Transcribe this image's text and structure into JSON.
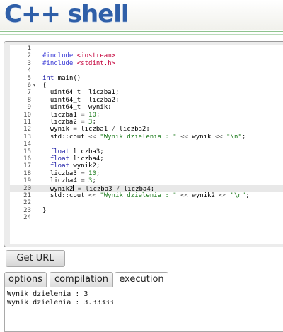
{
  "header": {
    "logo_text": "C++ shell"
  },
  "editor": {
    "active_line": 20,
    "lines": [
      {
        "n": "1",
        "fold": "",
        "html": ""
      },
      {
        "n": "2",
        "fold": "",
        "html": "<span class=\"tok-pp\">#include</span> <span class=\"tok-inc\">&lt;iostream&gt;</span>"
      },
      {
        "n": "3",
        "fold": "",
        "html": "<span class=\"tok-pp\">#include</span> <span class=\"tok-inc\">&lt;stdint.h&gt;</span>"
      },
      {
        "n": "4",
        "fold": "",
        "html": ""
      },
      {
        "n": "5",
        "fold": "",
        "html": "<span class=\"tok-kw\">int</span> main()"
      },
      {
        "n": "6",
        "fold": "▾",
        "html": "{"
      },
      {
        "n": "7",
        "fold": "",
        "html": "  uint64_t  liczba1;"
      },
      {
        "n": "8",
        "fold": "",
        "html": "  uint64_t  liczba2;"
      },
      {
        "n": "9",
        "fold": "",
        "html": "  uint64_t  wynik;"
      },
      {
        "n": "10",
        "fold": "",
        "html": "  liczba1 <span class=\"tok-op\">=</span> <span class=\"tok-num\">10</span>;"
      },
      {
        "n": "11",
        "fold": "",
        "html": "  liczba2 <span class=\"tok-op\">=</span> <span class=\"tok-num\">3</span>;"
      },
      {
        "n": "12",
        "fold": "",
        "html": "  wynik <span class=\"tok-op\">=</span> liczba1 <span class=\"tok-op\">/</span> liczba2;"
      },
      {
        "n": "13",
        "fold": "",
        "html": "  std::cout <span class=\"tok-op\">&lt;&lt;</span> <span class=\"tok-str\">\"Wynik dzielenia : \"</span> <span class=\"tok-op\">&lt;&lt;</span> wynik <span class=\"tok-op\">&lt;&lt;</span> <span class=\"tok-str\">\"\\n\"</span>;"
      },
      {
        "n": "14",
        "fold": "",
        "html": ""
      },
      {
        "n": "15",
        "fold": "",
        "html": "  <span class=\"tok-kw\">float</span> liczba3;"
      },
      {
        "n": "16",
        "fold": "",
        "html": "  <span class=\"tok-kw\">float</span> liczba4;"
      },
      {
        "n": "17",
        "fold": "",
        "html": "  <span class=\"tok-kw\">float</span> wynik2;"
      },
      {
        "n": "18",
        "fold": "",
        "html": "  liczba3 <span class=\"tok-op\">=</span> <span class=\"tok-num\">10</span>;"
      },
      {
        "n": "19",
        "fold": "",
        "html": "  liczba4 <span class=\"tok-op\">=</span> <span class=\"tok-num\">3</span>;"
      },
      {
        "n": "20",
        "fold": "",
        "html": "  wynik2<span class=\"cursor\"></span> <span class=\"tok-op\">=</span> liczba3 <span class=\"tok-op\">/</span> liczba4;"
      },
      {
        "n": "21",
        "fold": "",
        "html": "  std::cout <span class=\"tok-op\">&lt;&lt;</span> <span class=\"tok-str\">\"Wynik dzielenia : \"</span> <span class=\"tok-op\">&lt;&lt;</span> wynik2 <span class=\"tok-op\">&lt;&lt;</span> <span class=\"tok-str\">\"\\n\"</span>;"
      },
      {
        "n": "22",
        "fold": "",
        "html": ""
      },
      {
        "n": "23",
        "fold": "",
        "html": "}"
      },
      {
        "n": "24",
        "fold": "",
        "html": ""
      }
    ]
  },
  "get_url_label": "Get URL",
  "tabs": [
    {
      "label": "options",
      "active": false
    },
    {
      "label": "compilation",
      "active": false
    },
    {
      "label": "execution",
      "active": true
    }
  ],
  "output": {
    "lines": [
      "Wynik dzielenia : 3",
      "Wynik dzielenia : 3.33333"
    ]
  }
}
